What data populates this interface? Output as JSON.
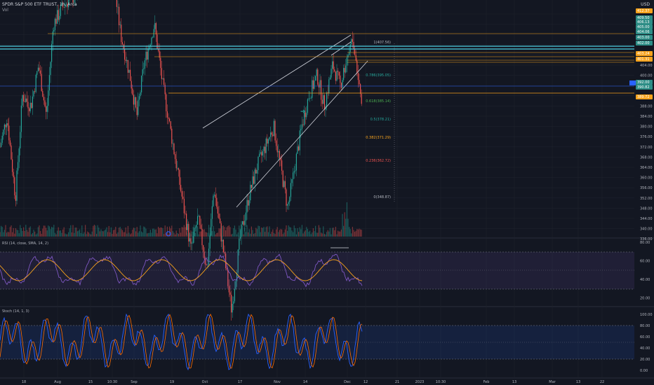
{
  "header": {
    "symbol_title": "SPDR S&P 500 ETF TRUST, 1h, Arca",
    "volume_label": "Vol",
    "currency": "USD"
  },
  "rsi_panel": {
    "label": "RSI (14, close, SMA, 14, 2)",
    "axis": [
      "80.00",
      "60.00",
      "40.00",
      "20.00"
    ]
  },
  "stoch_panel": {
    "label": "Stoch (14, 1, 3)",
    "axis": [
      "100.00",
      "80.00",
      "60.00",
      "40.00",
      "20.00",
      "0.00"
    ]
  },
  "price_axis": [
    "404.00",
    "400.00",
    "396.00",
    "392.00",
    "388.00",
    "384.00",
    "380.00",
    "376.00",
    "372.00",
    "368.00",
    "364.00",
    "360.00",
    "356.00",
    "352.00",
    "348.00",
    "344.00",
    "340.00",
    "336.00"
  ],
  "price_tags": [
    {
      "text": "412.37",
      "color": "#f7a21b"
    },
    {
      "text": "409.50",
      "color": "#2d8d86"
    },
    {
      "text": "406.13",
      "color": "#2d8d86"
    },
    {
      "text": "405.00",
      "color": "#2d8d86"
    },
    {
      "text": "404.06",
      "color": "#2d8d86"
    },
    {
      "text": "403.00",
      "color": "#2d8d86"
    },
    {
      "text": "402.00",
      "color": "#2d8d86"
    },
    {
      "text": "403.24",
      "color": "#f7a21b"
    },
    {
      "text": "401.31",
      "color": "#f7a21b"
    },
    {
      "text": "392.00",
      "color": "#2d8d86"
    },
    {
      "text": "390.82",
      "color": "#2d8d86"
    },
    {
      "text": "389.72",
      "color": "#f7a21b"
    }
  ],
  "fib_labels": [
    {
      "text": "1(407.56)",
      "color": "#b2b5be"
    },
    {
      "text": "0.786(395.05)",
      "color": "#26a69a"
    },
    {
      "text": "0.618(385.14)",
      "color": "#4caf50"
    },
    {
      "text": "0.5(378.21)",
      "color": "#26a69a"
    },
    {
      "text": "0.382(371.29)",
      "color": "#f7a21b"
    },
    {
      "text": "0.236(362.72)",
      "color": "#ef5350"
    },
    {
      "text": "0(348.87)",
      "color": "#b2b5be"
    }
  ],
  "time_axis": [
    "18",
    "Aug",
    "15",
    "10:30",
    "Sep",
    "19",
    "Oct",
    "17",
    "Nov",
    "14",
    "Dec",
    "12",
    "21",
    "2023",
    "10:30",
    "Feb",
    "13",
    "Mar",
    "13",
    "22"
  ],
  "colors": {
    "background": "#131722",
    "up": "#26a69a",
    "down": "#ef5350",
    "rsi_line": "#7e57c2",
    "rsi_ma": "#f7a21b",
    "stoch_k": "#2962ff",
    "stoch_d": "#ff6d00",
    "fib_line": "#f7a21b",
    "support_line": "#4dd0e1"
  }
}
